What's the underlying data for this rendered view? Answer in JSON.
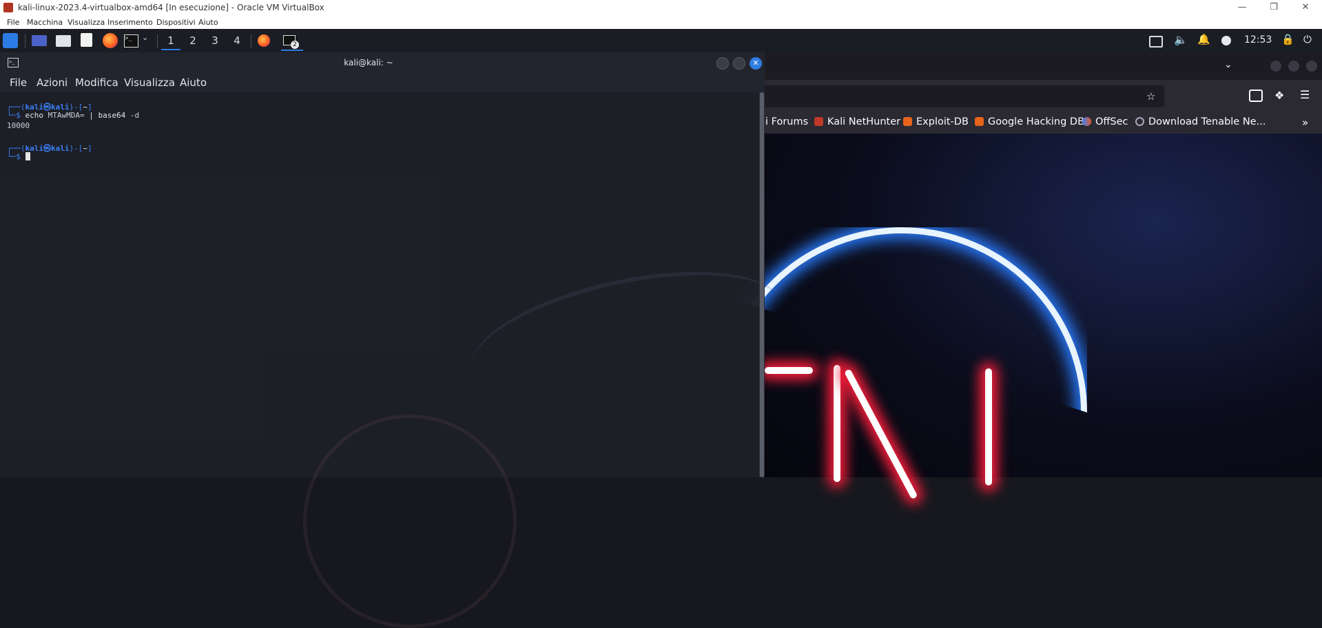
{
  "vbox": {
    "title": "kali-linux-2023.4-virtualbox-amd64 [In esecuzione] - Oracle VM VirtualBox",
    "menu": [
      "File",
      "Macchina",
      "Visualizza",
      "Inserimento",
      "Dispositivi",
      "Aiuto"
    ],
    "window_controls": [
      "minimize",
      "restore",
      "close"
    ]
  },
  "panel": {
    "workspaces": [
      "1",
      "2",
      "3",
      "4"
    ],
    "active_workspace": "1",
    "terminal_badge": "2",
    "clock": "12:53"
  },
  "terminal": {
    "title": "kali@kali: ~",
    "menu": [
      "File",
      "Azioni",
      "Modifica",
      "Visualizza",
      "Aiuto"
    ],
    "lines": {
      "prompt1_user": "kali",
      "prompt1_host": "kali",
      "prompt1_path": "~",
      "command1_cmd": "echo",
      "command1_arg": "MTAwMDA=",
      "command1_pipe": "|",
      "command1_cmd2": "base64",
      "command1_flag": "-d",
      "output1": "10000",
      "prompt2_user": "kali",
      "prompt2_host": "kali",
      "prompt2_path": "~"
    }
  },
  "browser": {
    "bookmarks": [
      "Kali Forums",
      "Kali NetHunter",
      "Exploit-DB",
      "Google Hacking DB",
      "OffSec",
      "Download Tenable Ne..."
    ],
    "bookmark_partial": "i Forums"
  },
  "colors": {
    "prompt_blue": "#3a7ff6",
    "panel_bg": "#1b1d24",
    "terminal_bg": "#1e2027",
    "close_blue": "#2f7de1",
    "neon_blue": "#2a7dff",
    "neon_red": "#ff1e3c"
  }
}
